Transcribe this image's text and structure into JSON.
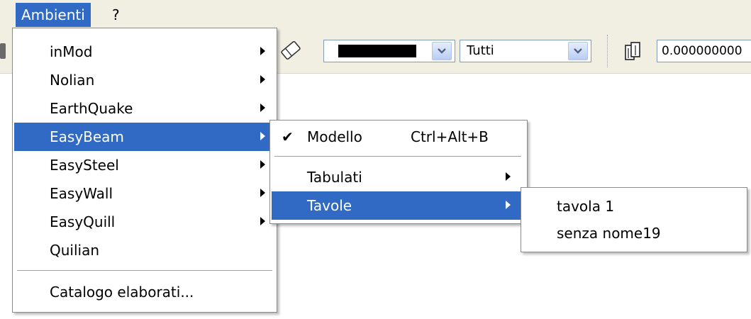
{
  "menubar": {
    "items": [
      {
        "label": "Ambienti"
      },
      {
        "label": "?"
      }
    ]
  },
  "toolbar": {
    "color_combo_value": "",
    "layer_combo_value": "Tutti",
    "numeric_value": "0.000000000",
    "icons": [
      "eraser-icon",
      "pages-icon",
      "dropdown-arrow-icon"
    ]
  },
  "menus": {
    "ambienti": {
      "items": [
        {
          "label": "inMod",
          "submenu": true
        },
        {
          "label": "Nolian",
          "submenu": true
        },
        {
          "label": "EarthQuake",
          "submenu": true
        },
        {
          "label": "EasyBeam",
          "submenu": true,
          "highlighted": true
        },
        {
          "label": "EasySteel",
          "submenu": true
        },
        {
          "label": "EasyWall",
          "submenu": true
        },
        {
          "label": "EasyQuill",
          "submenu": true
        },
        {
          "label": "Quilian",
          "submenu": false
        },
        {
          "label": "Catalogo elaborati...",
          "submenu": false
        }
      ]
    },
    "easybeam": {
      "modello": {
        "label": "Modello",
        "shortcut": "Ctrl+Alt+B",
        "checked": true
      },
      "tabulati": {
        "label": "Tabulati"
      },
      "tavole": {
        "label": "Tavole"
      }
    },
    "tavole": {
      "items": [
        {
          "label": "tavola 1"
        },
        {
          "label": "senza nome19"
        }
      ]
    }
  },
  "colors": {
    "highlight": "#316ac5",
    "menubar_bg": "#f1efe2"
  }
}
